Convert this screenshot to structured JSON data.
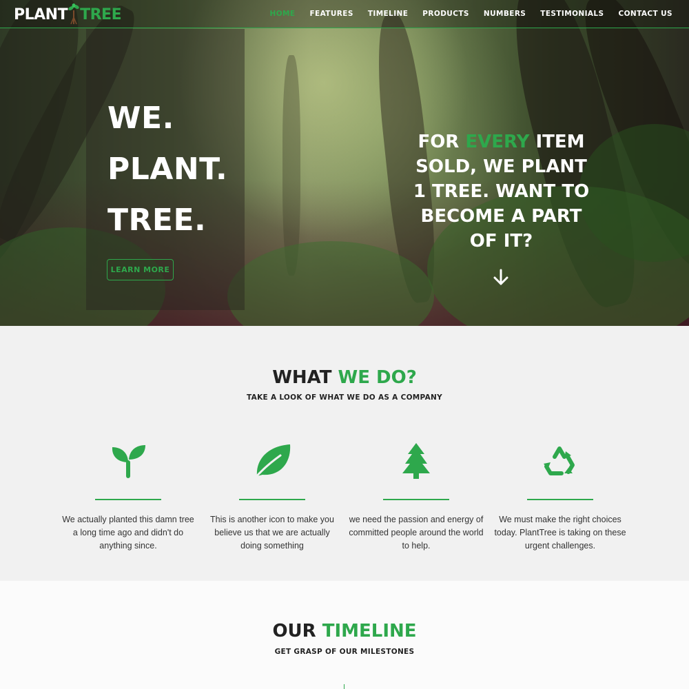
{
  "header": {
    "logo_plant": "PLANT",
    "logo_tree": "TREE",
    "nav": [
      "HOME",
      "FEATURES",
      "TIMELINE",
      "PRODUCTS",
      "NUMBERS",
      "TESTIMONIALS",
      "CONTACT US"
    ],
    "active_nav": "HOME"
  },
  "hero": {
    "title_lines": [
      "WE.",
      "PLANT.",
      "TREE."
    ],
    "cta_label": "LEARN MORE",
    "pitch_before": "FOR ",
    "pitch_highlight": "EVERY",
    "pitch_after": " ITEM SOLD, WE PLANT 1 TREE. WANT TO BECOME A PART OF IT?"
  },
  "whatwedo": {
    "heading_dark": "WHAT ",
    "heading_green": "WE DO?",
    "subheading": "TAKE A LOOK OF WHAT WE DO AS A COMPANY",
    "features": [
      {
        "icon": "sprout-icon",
        "text": "We actually planted this damn tree a long time ago and didn't do anything since."
      },
      {
        "icon": "leaf-icon",
        "text": "This is another icon to make you believe us that we are actually doing something"
      },
      {
        "icon": "pine-tree-icon",
        "text": "we need the passion and energy of committed people around the world to help."
      },
      {
        "icon": "recycle-icon",
        "text": "We must make the right choices today. PlantTree is taking on these urgent challenges."
      }
    ]
  },
  "timeline": {
    "heading_dark": "OUR ",
    "heading_green": "TIMELINE",
    "subheading": "GET GRASP OF OUR MILESTONES"
  },
  "colors": {
    "accent": "#2ea84c",
    "dark_text": "#222222"
  }
}
